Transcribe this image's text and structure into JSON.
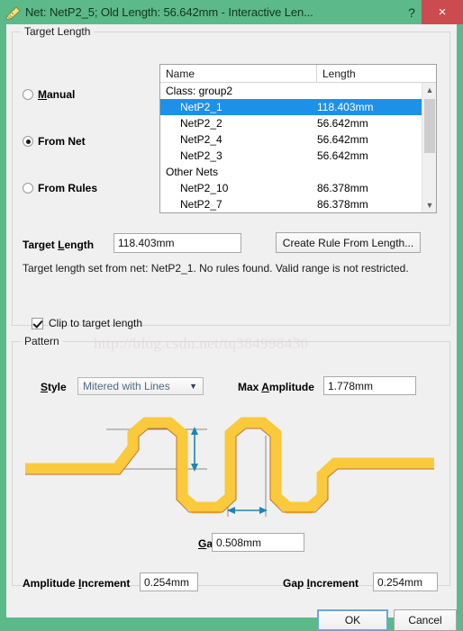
{
  "window": {
    "title": "Net: NetP2_5;  Old Length: 56.642mm  -  Interactive Len...",
    "icon": "ruler-pencil-icon",
    "help_label": "?",
    "close_label": "×",
    "titlebar_color": "#5cb98a",
    "close_color": "#cb4b4f"
  },
  "target_group": {
    "title": "Target Length",
    "modes": [
      {
        "label": "Manual",
        "accel": "M",
        "selected": false
      },
      {
        "label": "From Net",
        "accel": "F",
        "selected": true
      },
      {
        "label": "From Rules",
        "accel": "F",
        "selected": false
      }
    ],
    "list": {
      "columns": [
        "Name",
        "Length"
      ],
      "rows": [
        {
          "name": "Class: group2",
          "length": "",
          "group": true,
          "selected": false
        },
        {
          "name": "NetP2_1",
          "length": "118.403mm",
          "group": false,
          "selected": true
        },
        {
          "name": "NetP2_2",
          "length": "56.642mm",
          "group": false,
          "selected": false
        },
        {
          "name": "NetP2_4",
          "length": "56.642mm",
          "group": false,
          "selected": false
        },
        {
          "name": "NetP2_3",
          "length": "56.642mm",
          "group": false,
          "selected": false
        },
        {
          "name": "Other Nets",
          "length": "",
          "group": true,
          "selected": false
        },
        {
          "name": "NetP2_10",
          "length": "86.378mm",
          "group": false,
          "selected": false
        },
        {
          "name": "NetP2_7",
          "length": "86.378mm",
          "group": false,
          "selected": false
        }
      ],
      "selection_color": "#1e90e8",
      "scrollbar": {
        "up_icon": "chevron-up-icon",
        "down_icon": "chevron-down-icon"
      }
    },
    "target_length": {
      "label": "Target Length",
      "accel": "L",
      "value": "118.403mm"
    },
    "create_rule_button": "Create Rule From Length...",
    "info": "Target length set from net: NetP2_1.  No rules found. Valid range is not restricted.",
    "clip_checkbox": {
      "label": "Clip to target length",
      "checked": true
    }
  },
  "pattern_group": {
    "title": "Pattern",
    "style": {
      "label": "Style",
      "accel": "S",
      "value": "Mitered with Lines"
    },
    "max_amplitude": {
      "label": "Max Amplitude",
      "accel": "A",
      "value": "1.778mm"
    },
    "gap": {
      "label": "Gap",
      "accel": "G",
      "value": "0.508mm"
    },
    "amplitude_increment": {
      "label": "Amplitude Increment",
      "accel": "I",
      "value": "0.254mm"
    },
    "gap_increment": {
      "label": "Gap Increment",
      "accel": "I",
      "value": "0.254mm"
    },
    "diagram": {
      "trace_color": "#fac93c",
      "centerline_color": "#b5651d",
      "dimension_color": "#1b86b4",
      "guide_color": "#8b8b8b",
      "amplitude_arrow": "vertical-double-arrow",
      "gap_arrow": "horizontal-double-arrow"
    }
  },
  "footer": {
    "ok": "OK",
    "cancel": "Cancel"
  },
  "watermark": "http://blog.csdn.net/tq384998430"
}
